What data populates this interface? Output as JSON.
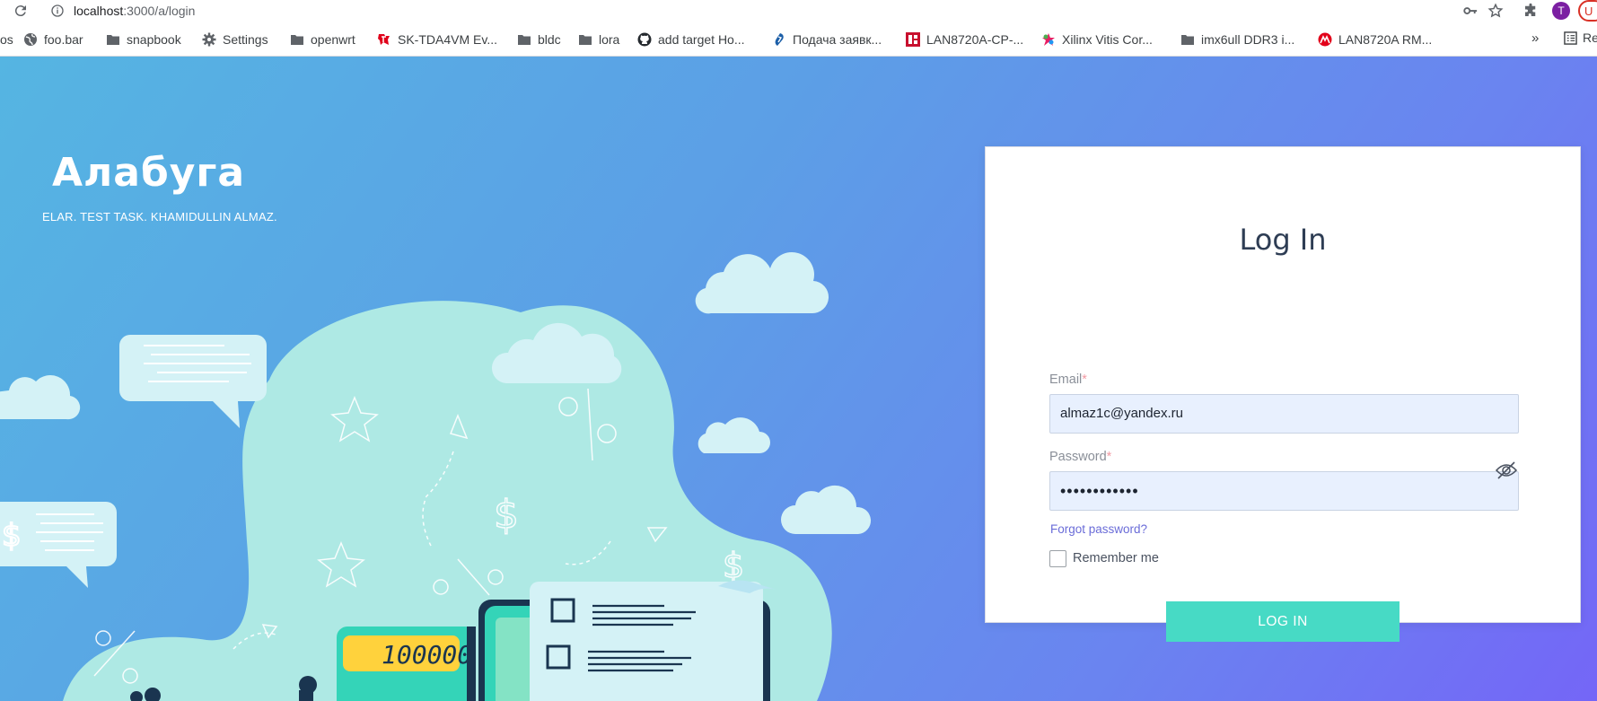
{
  "browser": {
    "url_host": "localhost",
    "url_path": ":3000/a/login",
    "profile_initial": "T",
    "profile_partial": "U"
  },
  "bookmarks": [
    {
      "label": "os",
      "icon": "none"
    },
    {
      "label": "foo.bar",
      "icon": "globe-icon"
    },
    {
      "label": "snapbook",
      "icon": "folder-icon"
    },
    {
      "label": "Settings",
      "icon": "gear-icon"
    },
    {
      "label": "openwrt",
      "icon": "folder-icon"
    },
    {
      "label": "SK-TDA4VM Ev...",
      "icon": "ti-logo-icon"
    },
    {
      "label": "bldc",
      "icon": "folder-icon"
    },
    {
      "label": "lora",
      "icon": "folder-icon"
    },
    {
      "label": "add target Ho...",
      "icon": "github-icon"
    },
    {
      "label": "Подача заявк...",
      "icon": "brand-icon"
    },
    {
      "label": "LAN8720A-CP-...",
      "icon": "red-brand-icon"
    },
    {
      "label": "Xilinx Vitis Cor...",
      "icon": "xilinx-icon"
    },
    {
      "label": "imx6ull DDR3 i...",
      "icon": "folder-icon"
    },
    {
      "label": "LAN8720A RM...",
      "icon": "microchip-icon"
    }
  ],
  "bookmarks_overflow": "»",
  "reading_list_partial": "Re",
  "brand": {
    "title": "Алабуга",
    "subtitle": "ELAR. TEST TASK. KHAMIDULLIN ALMAZ."
  },
  "illustration": {
    "calculator_display": "100000"
  },
  "login": {
    "title": "Log In",
    "email_label": "Email",
    "email_value": "almaz1c@yandex.ru",
    "password_label": "Password",
    "password_value": "••••••••••••",
    "required_mark": "*",
    "forgot_link": "Forgot password?",
    "remember_label": "Remember me",
    "submit_label": "LOG IN"
  },
  "colors": {
    "accent_button": "#47dac5",
    "link": "#6a6cd8",
    "input_bg": "#e8f0fe",
    "gradient_start": "#55b5e2",
    "gradient_end": "#7466f7"
  }
}
